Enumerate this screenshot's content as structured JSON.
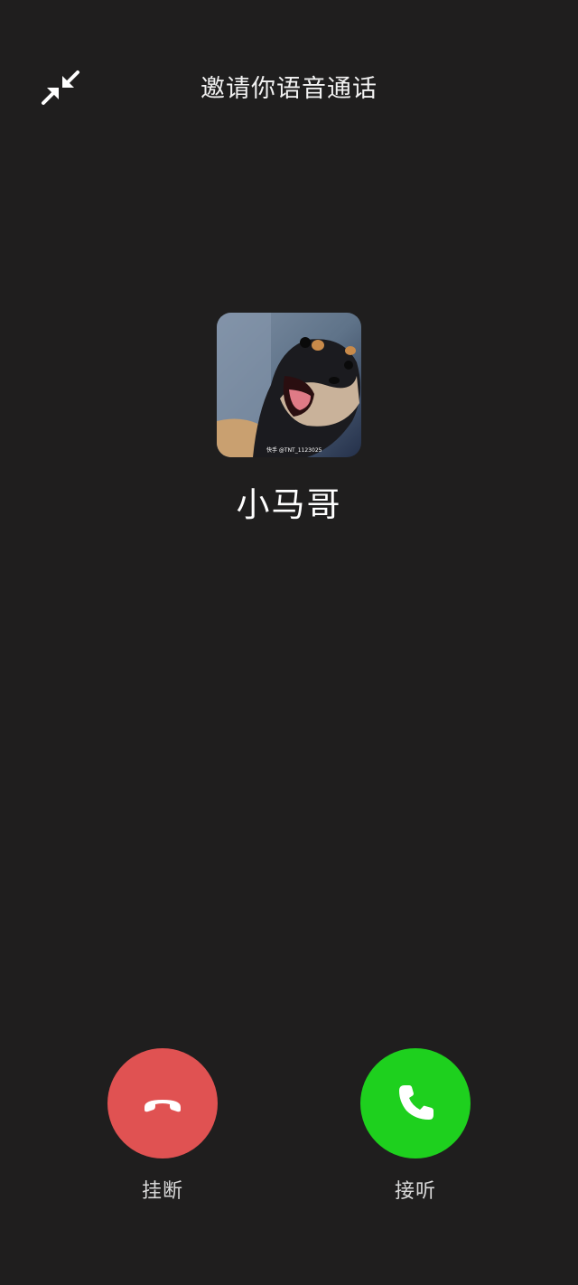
{
  "header": {
    "title": "邀请你语音通话",
    "minimize_icon": "minimize-arrows-icon"
  },
  "caller": {
    "name": "小马哥",
    "avatar_watermark": "快手 @TNT_1123025"
  },
  "actions": {
    "hangup": {
      "label": "挂断",
      "icon": "phone-hangup-icon",
      "color": "#e05252"
    },
    "answer": {
      "label": "接听",
      "icon": "phone-icon",
      "color": "#1ed01e"
    }
  },
  "theme": {
    "background": "#1f1e1e"
  }
}
